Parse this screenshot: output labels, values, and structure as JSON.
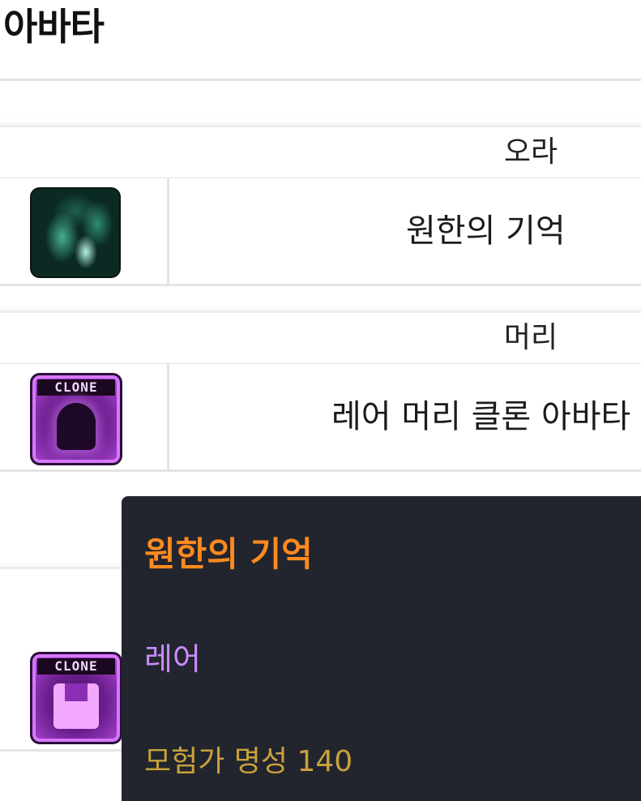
{
  "page": {
    "title": "아바타"
  },
  "sections": [
    {
      "header": "오라",
      "item_name": "원한의 기억",
      "icon": "aura-flame-icon"
    },
    {
      "header": "머리",
      "item_name": "레어 머리 클론 아바타",
      "icon": "clone-head-icon",
      "icon_label": "CLONE"
    },
    {
      "header": "",
      "item_name": "",
      "icon": "clone-top-icon",
      "icon_label": "CLONE"
    }
  ],
  "tooltip": {
    "title": "원한의 기억",
    "rarity": "레어",
    "fame": "모험가 명성 140",
    "colors": {
      "title": "#ff8a1f",
      "rarity": "#c98bff",
      "fame": "#c8a23a",
      "background": "#22252e"
    }
  }
}
